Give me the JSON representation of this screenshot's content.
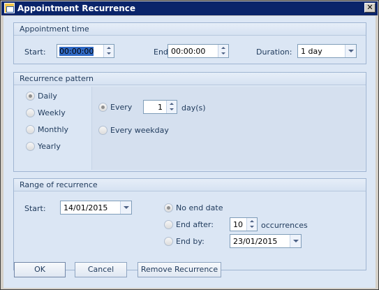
{
  "window": {
    "title": "Appointment Recurrence",
    "close_glyph": "✕"
  },
  "appointment_time": {
    "header": "Appointment time",
    "start_label": "Start:",
    "start_value": "00:00:00",
    "end_label": "End:",
    "end_value": "00:00:00",
    "duration_label": "Duration:",
    "duration_value": "1 day"
  },
  "recurrence_pattern": {
    "header": "Recurrence pattern",
    "options": [
      "Daily",
      "Weekly",
      "Monthly",
      "Yearly"
    ],
    "selected": "Daily",
    "every_label": "Every",
    "every_value": "1",
    "every_unit": "day(s)",
    "every_weekday_label": "Every weekday"
  },
  "range": {
    "header": "Range of recurrence",
    "start_label": "Start:",
    "start_value": "14/01/2015",
    "no_end_label": "No end date",
    "end_after_label": "End after:",
    "end_after_value": "10",
    "occurrences_label": "occurrences",
    "end_by_label": "End by:",
    "end_by_value": "23/01/2015"
  },
  "buttons": {
    "ok": "OK",
    "cancel": "Cancel",
    "remove": "Remove Recurrence"
  }
}
